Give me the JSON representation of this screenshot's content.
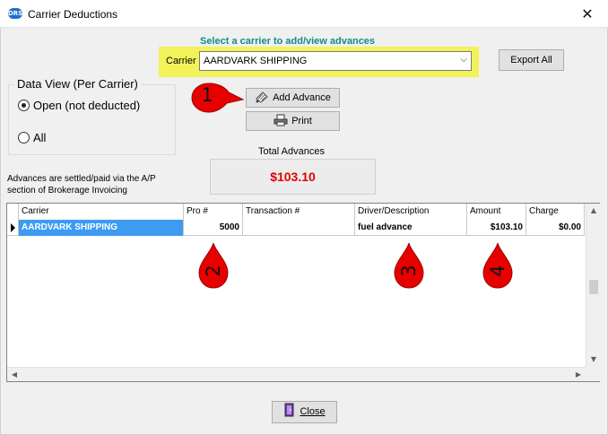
{
  "window": {
    "title": "Carrier Deductions",
    "app_icon_text": "DRS"
  },
  "header": {
    "select_hint": "Select a carrier to add/view advances"
  },
  "carrier": {
    "label": "Carrier",
    "selected": "AARDVARK SHIPPING"
  },
  "buttons": {
    "export_all": "Export All",
    "add_advance": "Add Advance",
    "print": "Print",
    "close": "Close"
  },
  "data_view": {
    "legend": "Data View (Per Carrier)",
    "options": [
      {
        "label": "Open (not deducted)",
        "selected": true
      },
      {
        "label": "All",
        "selected": false
      }
    ]
  },
  "totals": {
    "label": "Total Advances",
    "value": "$103.10",
    "value_color": "#e00000"
  },
  "note": {
    "line1": "Advances are settled/paid via the A/P",
    "line2": "section of Brokerage Invoicing"
  },
  "grid": {
    "columns": [
      "Carrier",
      "Pro #",
      "Transaction #",
      "Driver/Description",
      "Amount",
      "Charge"
    ],
    "rows": [
      {
        "carrier": "AARDVARK SHIPPING",
        "pro": "5000",
        "transaction": "",
        "description": "fuel advance",
        "amount": "$103.10",
        "charge": "$0.00"
      }
    ]
  },
  "annotations": {
    "color": "#e60000",
    "markers": [
      "1",
      "2",
      "3",
      "4"
    ]
  },
  "colors": {
    "highlight": "#f2f25a",
    "selection": "#3d9bf2",
    "hint_text": "#138a8a"
  }
}
